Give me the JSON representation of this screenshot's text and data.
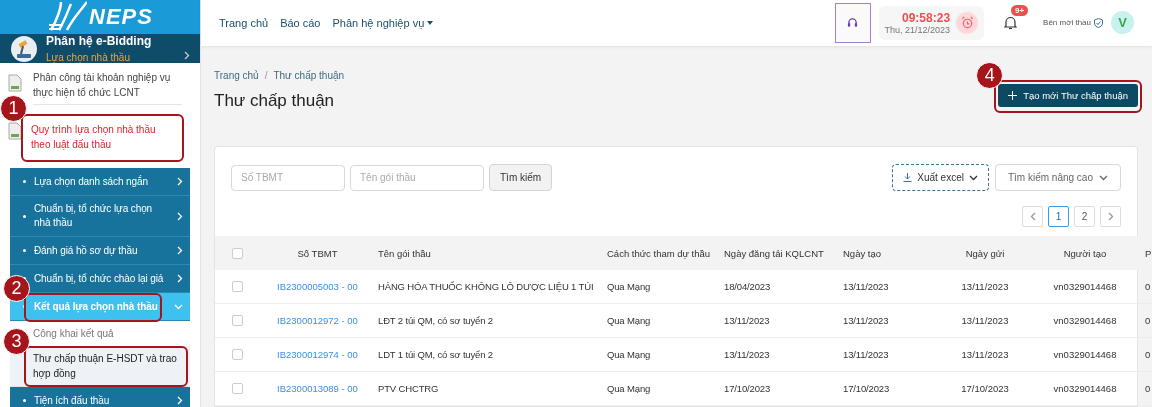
{
  "sidebar": {
    "logo_text": "NEPS",
    "module": {
      "title": "Phân hệ e-Bidding",
      "subtitle": "Lựa chọn nhà thầu"
    },
    "items": [
      {
        "kind": "page",
        "label": "Phân công tài khoản nghiệp vụ thực hiện tổ chức LCNT",
        "selected": false
      },
      {
        "kind": "page",
        "label": "Quy trình lựa chọn nhà thầu theo luật đấu thầu",
        "selected": true,
        "callout": "1"
      },
      {
        "kind": "group",
        "label": "Lựa chọn danh sách ngắn",
        "expanded": false
      },
      {
        "kind": "group",
        "label": "Chuẩn bị, tổ chức lựa chọn nhà thầu",
        "expanded": false
      },
      {
        "kind": "group",
        "label": "Đánh giá hồ sơ dự thầu",
        "expanded": false
      },
      {
        "kind": "group",
        "label": "Chuẩn bị, tổ chức chào lại giá",
        "expanded": false
      },
      {
        "kind": "group",
        "label": "Kết quả lựa chọn nhà thầu",
        "expanded": true,
        "callout": "2",
        "children": [
          {
            "label": "Công khai kết quả",
            "selected": false
          },
          {
            "label": "Thư chấp thuận E-HSDT và trao hợp đồng",
            "selected": true,
            "callout": "3"
          }
        ]
      },
      {
        "kind": "group",
        "label": "Tiện ích đấu thầu",
        "expanded": false
      }
    ]
  },
  "topbar": {
    "nav": [
      {
        "label": "Trang chủ",
        "dropdown": false
      },
      {
        "label": "Báo cáo",
        "dropdown": false
      },
      {
        "label": "Phân hệ nghiệp vụ",
        "dropdown": true
      }
    ],
    "clock": {
      "time": "09:58:23",
      "date": "Thu, 21/12/2023"
    },
    "notifications": {
      "badge": "9+"
    },
    "user": {
      "role": "Bên mời thầu",
      "avatar": "V"
    }
  },
  "page": {
    "breadcrumb": [
      "Trang chủ",
      "Thư chấp thuận"
    ],
    "breadcrumb_separator": "/",
    "title": "Thư chấp thuận",
    "create_button": {
      "label": "Tạo mới Thư chấp thuận",
      "callout": "4"
    }
  },
  "filters": {
    "fields": [
      {
        "placeholder": "Số TBMT"
      },
      {
        "placeholder": "Tên gói thầu"
      }
    ],
    "search_button": "Tìm kiếm",
    "export_button": "Xuất excel",
    "advanced_button": "Tìm kiếm nâng cao"
  },
  "pagination": [
    {
      "label": "1",
      "selected": true
    },
    {
      "label": "2",
      "selected": false
    }
  ],
  "table": {
    "all_checked": false,
    "columns": [
      "Số TBMT",
      "Tên gói thầu",
      "Cách thức tham dự thầu",
      "Ngày đăng tải KQLCNT",
      "Ngày tạo",
      "Ngày gửi",
      "Người tạo",
      "P"
    ],
    "rows": [
      {
        "checked": false,
        "cells": [
          "IB2300005003 - 00",
          "HÀNG HÓA THUỐC KHÔNG LÔ DƯỢC LIỆU 1 TÚI",
          "Qua Mạng",
          "18/04/2023",
          "13/11/2023",
          "13/11/2023",
          "vn0329014468",
          "0"
        ]
      },
      {
        "checked": false,
        "cells": [
          "IB2300012972 - 00",
          "LĐT 2 túi QM, có sơ tuyển 2",
          "Qua Mạng",
          "13/11/2023",
          "13/11/2023",
          "13/11/2023",
          "vn0329014468",
          "0"
        ]
      },
      {
        "checked": false,
        "cells": [
          "IB2300012974 - 00",
          "LDT 1 túi QM, có sơ tuyển 2",
          "Qua Mạng",
          "13/11/2023",
          "13/11/2023",
          "13/11/2023",
          "vn0329014468",
          "0"
        ]
      },
      {
        "checked": false,
        "cells": [
          "IB2300013089 - 00",
          "PTV CHCTRG",
          "Qua Mạng",
          "17/10/2023",
          "17/10/2023",
          "17/10/2023",
          "vn0329014468",
          "0"
        ]
      }
    ]
  }
}
